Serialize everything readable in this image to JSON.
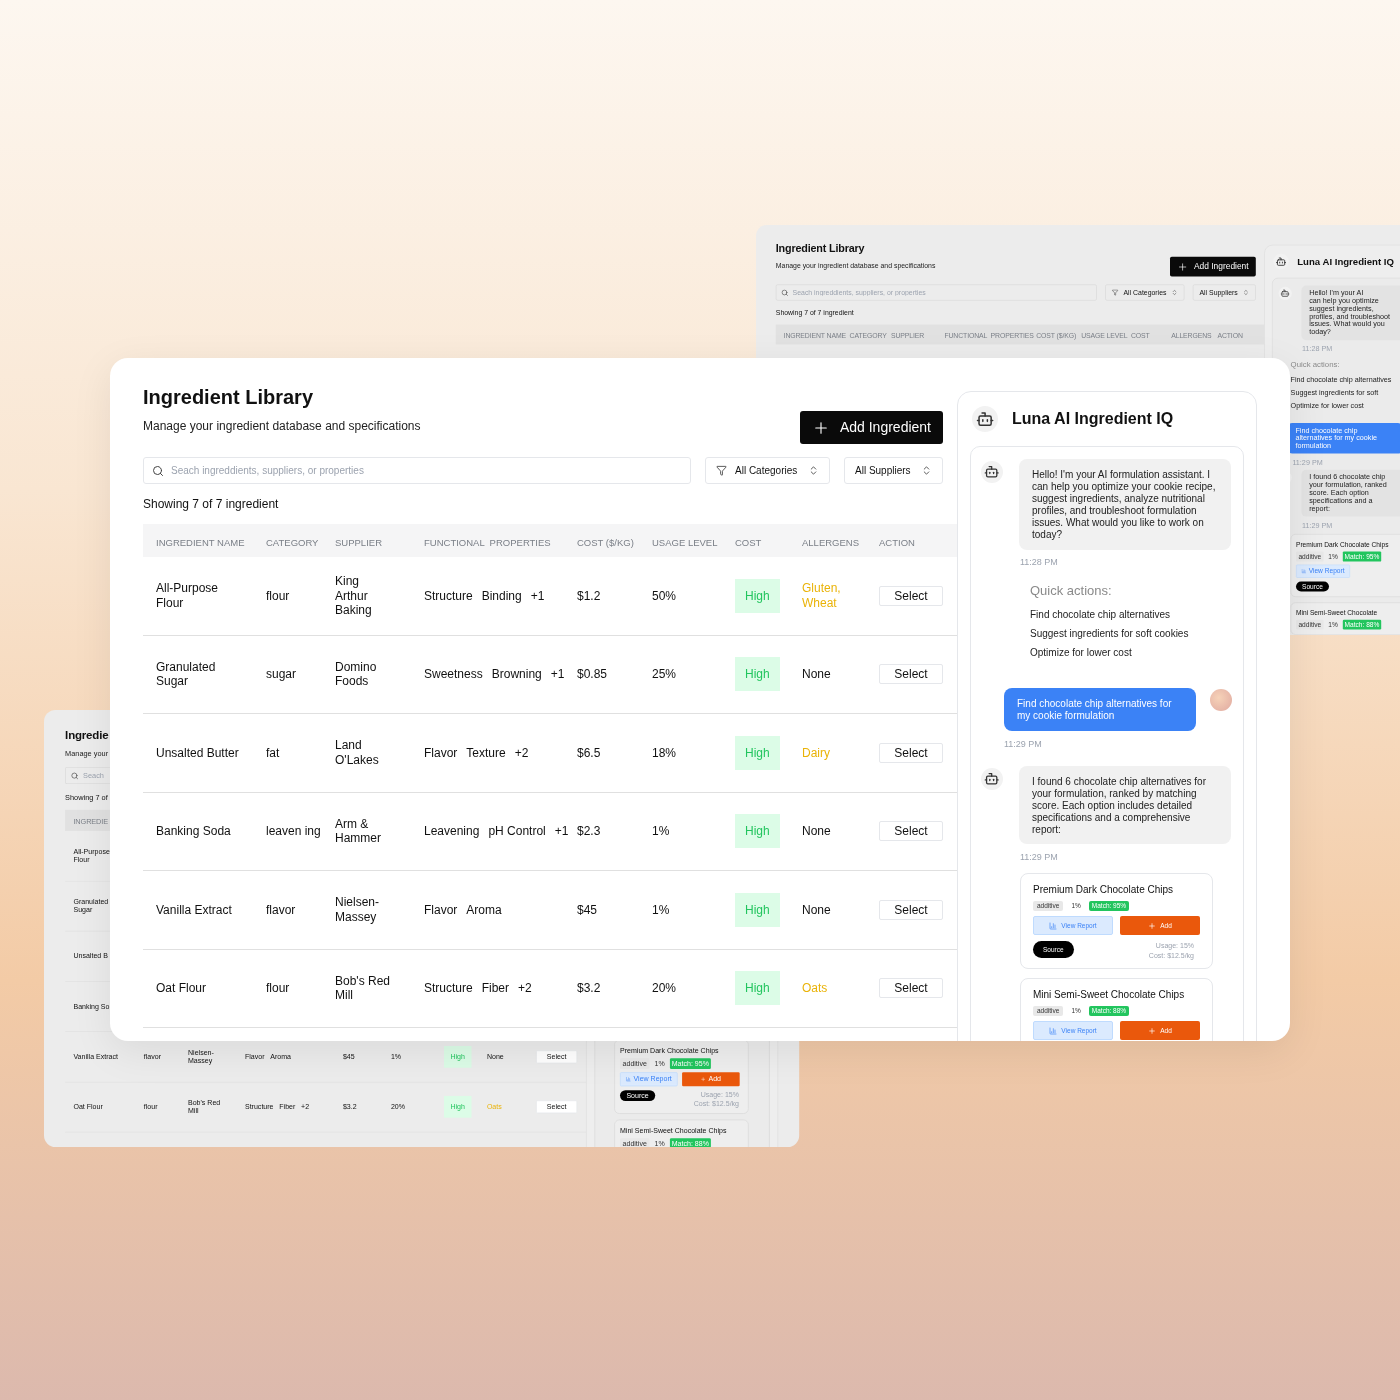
{
  "windows": [
    {
      "kind": "background",
      "title": "Ingredient Library",
      "subtitle": "Manage your ingredient database and specifications",
      "add_button": "Add Ingredient",
      "search_placeholder": "Seach ingreddients, suppliers, or properties",
      "filters": [
        {
          "label": "All Categories",
          "kind": "filter"
        },
        {
          "label": "All Suppliers",
          "kind": "plain"
        }
      ],
      "showing": "Showing 7 of 7 ingredient",
      "columns": [
        "INGREDIENT NAME",
        "CATEGORY",
        "SUPPLIER",
        "FUNCTIONAL  PROPERTIES",
        "COST ($/KG)",
        "USAGE LEVEL",
        "COST",
        "ALLERGENS",
        "ACTION"
      ],
      "chat": {
        "title": "Luna AI Ingredient IQ",
        "greeting": {
          "lines": [
            "Hello! I'm your AI",
            "can help you optimize",
            "suggest ingredients,",
            "profiles, and troubleshoot",
            "issues. What would you",
            "today?"
          ],
          "time": "11:28 PM"
        },
        "quick_actions": {
          "heading": "Quick actions:",
          "items": [
            "Find chocolate chip alternatives",
            "Suggest ingredients for soft",
            "Optimize for lower cost"
          ]
        },
        "request": {
          "text": "Find chocolate chip alternatives for my cookie formulation",
          "time": "11:29 PM"
        },
        "reply": {
          "lines": [
            "I found 6 chocolate chip",
            "your formulation, ranked",
            "score. Each option",
            "specifications and a",
            "report:"
          ],
          "time": "11:29 PM"
        },
        "cards": [
          {
            "title": "Premium Dark Chocolate Chips",
            "tags": [
              {
                "label": "additive",
                "kind": "type"
              },
              {
                "label": "1%",
                "kind": "plain"
              }
            ],
            "match": "Match: 95%",
            "view_button": "View Report",
            "source_button": "Source"
          },
          {
            "title": "Mini Semi-Sweet Chocolate",
            "tags": [
              {
                "label": "additive",
                "kind": "type"
              },
              {
                "label": "1%",
                "kind": "plain"
              }
            ],
            "match": "Match: 88%"
          }
        ]
      }
    },
    {
      "kind": "background",
      "title": "Ingredie",
      "subtitle": "Manage your",
      "search_placeholder": "Seach",
      "showing": "Showing 7 of",
      "columns": [
        "INGREDIE"
      ],
      "rows": [
        {
          "name": "All-Purpose Flour"
        },
        {
          "name": "Granulated Sugar"
        },
        {
          "name": "Unsalted B"
        },
        {
          "name": "Banking So"
        },
        {
          "name": "Vanilla Extract",
          "category": "flavor",
          "supplier": "Nielsen-Massey",
          "properties": [
            "Flavor",
            "Aroma"
          ],
          "cost": "$45",
          "usage": "1%",
          "level": "High",
          "allergens": "None",
          "allergen_warning": false,
          "action": "Select"
        },
        {
          "name": "Oat Flour",
          "category": "flour",
          "supplier": "Bob's Red Mill",
          "properties": [
            "Structure",
            "Fiber",
            "+2"
          ],
          "cost": "$3.2",
          "usage": "20%",
          "level": "High",
          "allergens": "Oats",
          "allergen_warning": true,
          "action": "Select"
        }
      ],
      "chat": {
        "cards": [
          {
            "title": "Premium Dark Chocolate Chips",
            "tags": [
              {
                "label": "additive",
                "kind": "type"
              },
              {
                "label": "1%",
                "kind": "plain"
              }
            ],
            "match": "Match: 95%",
            "view_button": "View Report",
            "add_button": "Add",
            "source_button": "Source",
            "usage": "Usage: 15%",
            "cost": "Cost: $12.5/kg"
          },
          {
            "title": "Mini Semi-Sweet Chocolate Chips",
            "tags": [
              {
                "label": "additive",
                "kind": "type"
              },
              {
                "label": "1%",
                "kind": "plain"
              }
            ],
            "match": "Match: 88%"
          }
        ]
      }
    },
    {
      "kind": "main",
      "title": "Ingredient Library",
      "subtitle": "Manage your ingredient database and specifications",
      "add_button": "Add Ingredient",
      "search_placeholder": "Seach ingreddients, suppliers, or properties",
      "filters": [
        {
          "label": "All Categories",
          "kind": "filter"
        },
        {
          "label": "All Suppliers",
          "kind": "plain"
        }
      ],
      "showing": "Showing 7 of 7 ingredient",
      "columns": [
        "INGREDIENT NAME",
        "CATEGORY",
        "SUPPLIER",
        "FUNCTIONAL  PROPERTIES",
        "COST ($/KG)",
        "USAGE LEVEL",
        "COST",
        "ALLERGENS",
        "ACTION"
      ],
      "rows": [
        {
          "name": "All-Purpose Flour",
          "category": "flour",
          "supplier": "King Arthur Baking",
          "properties": [
            "Structure",
            "Binding",
            "+1"
          ],
          "cost": "$1.2",
          "usage": "50%",
          "level": "High",
          "allergens": "Gluten, Wheat",
          "allergen_warning": true,
          "action": "Select"
        },
        {
          "name": "Granulated Sugar",
          "category": "sugar",
          "supplier": "Domino Foods",
          "properties": [
            "Sweetness",
            "Browning",
            "+1"
          ],
          "cost": "$0.85",
          "usage": "25%",
          "level": "High",
          "allergens": "None",
          "allergen_warning": false,
          "action": "Select"
        },
        {
          "name": "Unsalted Butter",
          "category": "fat",
          "supplier": "Land O'Lakes",
          "properties": [
            "Flavor",
            "Texture",
            "+2"
          ],
          "cost": "$6.5",
          "usage": "18%",
          "level": "High",
          "allergens": "Dairy",
          "allergen_warning": true,
          "action": "Select"
        },
        {
          "name": "Banking Soda",
          "category": "leaven ing",
          "supplier": "Arm & Hammer",
          "properties": [
            "Leavening",
            "pH Control",
            "+1"
          ],
          "cost": "$2.3",
          "usage": "1%",
          "level": "High",
          "allergens": "None",
          "allergen_warning": false,
          "action": "Select"
        },
        {
          "name": "Vanilla Extract",
          "category": "flavor",
          "supplier": "Nielsen-Massey",
          "properties": [
            "Flavor",
            "Aroma"
          ],
          "cost": "$45",
          "usage": "1%",
          "level": "High",
          "allergens": "None",
          "allergen_warning": false,
          "action": "Select"
        },
        {
          "name": "Oat Flour",
          "category": "flour",
          "supplier": "Bob's Red Mill",
          "properties": [
            "Structure",
            "Fiber",
            "+2"
          ],
          "cost": "$3.2",
          "usage": "20%",
          "level": "High",
          "allergens": "Oats",
          "allergen_warning": true,
          "action": "Select"
        }
      ],
      "chat": {
        "title": "Luna AI Ingredient IQ",
        "greeting": {
          "text": "Hello! I'm your AI formulation assistant. I can help you optimize your cookie recipe, suggest ingredients, analyze nutritional profiles, and troubleshoot formulation issues. What would you like to work on today?",
          "time": "11:28 PM"
        },
        "quick_actions": {
          "heading": "Quick actions:",
          "items": [
            "Find chocolate chip alternatives",
            "Suggest ingredients for soft cookies",
            "Optimize for lower cost"
          ]
        },
        "request": {
          "text": "Find chocolate chip alternatives for my cookie formulation",
          "time": "11:29 PM",
          "avatar": true
        },
        "reply": {
          "text": "I found 6 chocolate chip alternatives for your formulation, ranked by matching score. Each option includes detailed specifications and a comprehensive report:",
          "time": "11:29 PM"
        },
        "cards": [
          {
            "title": "Premium Dark Chocolate Chips",
            "tags": [
              {
                "label": "additive",
                "kind": "type"
              },
              {
                "label": "1%",
                "kind": "plain"
              }
            ],
            "match": "Match: 95%",
            "view_button": "View Report",
            "add_button": "Add",
            "source_button": "Source",
            "usage": "Usage: 15%",
            "cost": "Cost: $12.5/kg"
          },
          {
            "title": "Mini Semi-Sweet Chocolate Chips",
            "tags": [
              {
                "label": "additive",
                "kind": "type"
              },
              {
                "label": "1%",
                "kind": "plain"
              }
            ],
            "match": "Match: 88%",
            "view_button": "View Report",
            "add_button": "Add"
          }
        ]
      }
    }
  ]
}
